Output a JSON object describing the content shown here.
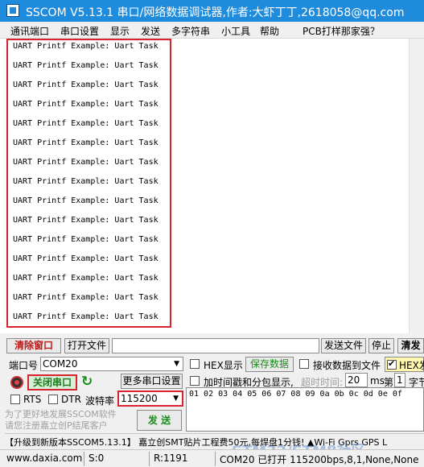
{
  "window": {
    "title": "SSCOM V5.13.1 串口/网络数据调试器,作者:大虾丁丁,2618058@qq.com"
  },
  "menu": [
    "通讯端口",
    "串口设置",
    "显示",
    "发送",
    "多字符串",
    "小工具",
    "帮助",
    "PCB打样那家强？"
  ],
  "receive": {
    "lines": [
      "UART Printf Example: Uart Task",
      "UART Printf Example: Uart Task",
      "UART Printf Example: Uart Task",
      "UART Printf Example: Uart Task",
      "UART Printf Example: Uart Task",
      "UART Printf Example: Uart Task",
      "UART Printf Example: Uart Task",
      "UART Printf Example: Uart Task",
      "UART Printf Example: Uart Task",
      "UART Printf Example: Uart Task",
      "UART Printf Example: Uart Task",
      "UART Printf Example: Uart Task",
      "UART Printf Example: Uart Task",
      "UART Printf Example: Uart Task",
      "UART Printf Example: Uart Task"
    ]
  },
  "toolbar": {
    "clear_label": "清除窗口",
    "open_file_label": "打开文件",
    "send_file_label": "发送文件",
    "stop_label": "停止",
    "clear_send_label": "清发"
  },
  "port": {
    "port_label": "端口号",
    "port_value": "COM20",
    "close_port_label": "关闭串口",
    "more_settings_label": "更多串口设置",
    "rts_label": "RTS",
    "dtr_label": "DTR",
    "baud_label": "波特率",
    "baud_value": "115200"
  },
  "options": {
    "hex_display_label": "HEX显示",
    "save_data_label": "保存数据",
    "receive_to_file_label": "接收数据到文件",
    "hex_send_label": "HEX发",
    "timestamp_label": "加时间戳和分包显示,",
    "timeout_label": "超时时间:",
    "timeout_value": "20",
    "timeout_unit": "ms",
    "nth_label": "第",
    "nth_value": "1",
    "byte_label": "字节"
  },
  "send": {
    "hex_data": "01 02 03 04 05 06 07 08 09 0a 0b 0c 0d 0e 0f",
    "send_label": "发 送",
    "promo_text": "为了更好地发展SSCOM软件\n请您注册嘉立创P结尾客户"
  },
  "ticker": "【升级到新版本SSCOM5.13.1】    嘉立创SMT贴片工程费50元,每焊盘1分钱! ▲Wi-Fi Gprs GPS L",
  "status": {
    "website": "www.daxia.com",
    "sent": "S:0",
    "received": "R:1191",
    "port_status": "COM20 已打开  115200bps,8,1,None,None"
  },
  "watermark": "STM32/STM8社区",
  "colors": {
    "title_bar": "#1f8bdc",
    "highlight_red": "#d8242f",
    "close_port_green": "#1a8c1a"
  }
}
